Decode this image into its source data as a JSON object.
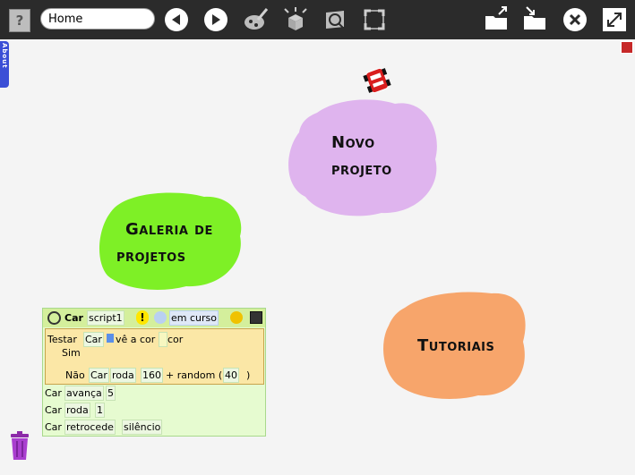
{
  "toolbar": {
    "help_label": "?",
    "home_value": "Home"
  },
  "about_tab": "About",
  "clouds": {
    "novo_projeto": {
      "line1": "Novo",
      "line2": "projeto",
      "color": "#dfb4ee"
    },
    "galeria": {
      "line1": "Galeria de",
      "line2": "projetos",
      "color": "#7ef026"
    },
    "tutoriais": {
      "line1": "Tutoriais",
      "color": "#f7a56b"
    }
  },
  "script": {
    "header": {
      "object": "Car",
      "name": "script1",
      "status": "em curso"
    },
    "test": {
      "testar": "Testar",
      "car1": "Car",
      "ve_cor": "vê a cor",
      "cor": "cor",
      "sim": "Sim",
      "nao": "Não",
      "car2": "Car",
      "roda": "roda",
      "n160": "160",
      "plus_random": "+ random (",
      "n40": "40",
      "close_paren": ")"
    },
    "rows": [
      {
        "object": "Car",
        "action": "avança",
        "value": "5"
      },
      {
        "object": "Car",
        "action": "roda",
        "value": "1"
      },
      {
        "object": "Car",
        "action": "retrocede",
        "value": "silêncio"
      }
    ]
  },
  "colors": {
    "toolbar": "#2b2b2b",
    "background": "#f4f4f4",
    "about_tab": "#3b4fd6"
  }
}
